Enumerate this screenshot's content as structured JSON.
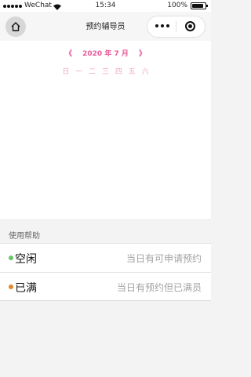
{
  "status": {
    "carrier": "WeChat",
    "time": "15:34",
    "battery": "100%",
    "battery_level": 1.0
  },
  "nav": {
    "title": "预约辅导员",
    "home_icon": "home-icon",
    "more_icon": "more-dots-icon",
    "close_icon": "target-icon"
  },
  "calendar": {
    "prev": "《",
    "month_label": "2020 年 7 月",
    "next": "》",
    "weekdays": [
      "日",
      "一",
      "二",
      "三",
      "四",
      "五",
      "六"
    ],
    "month_color": "#e95b9a",
    "weekday_color": "#f2a6c7"
  },
  "help": {
    "title": "使用帮助",
    "items": [
      {
        "label": "空闲",
        "desc": "当日有可申请预约",
        "color": "#6cc36c"
      },
      {
        "label": "已满",
        "desc": "当日有预约但已满员",
        "color": "#e08a2c"
      }
    ]
  }
}
